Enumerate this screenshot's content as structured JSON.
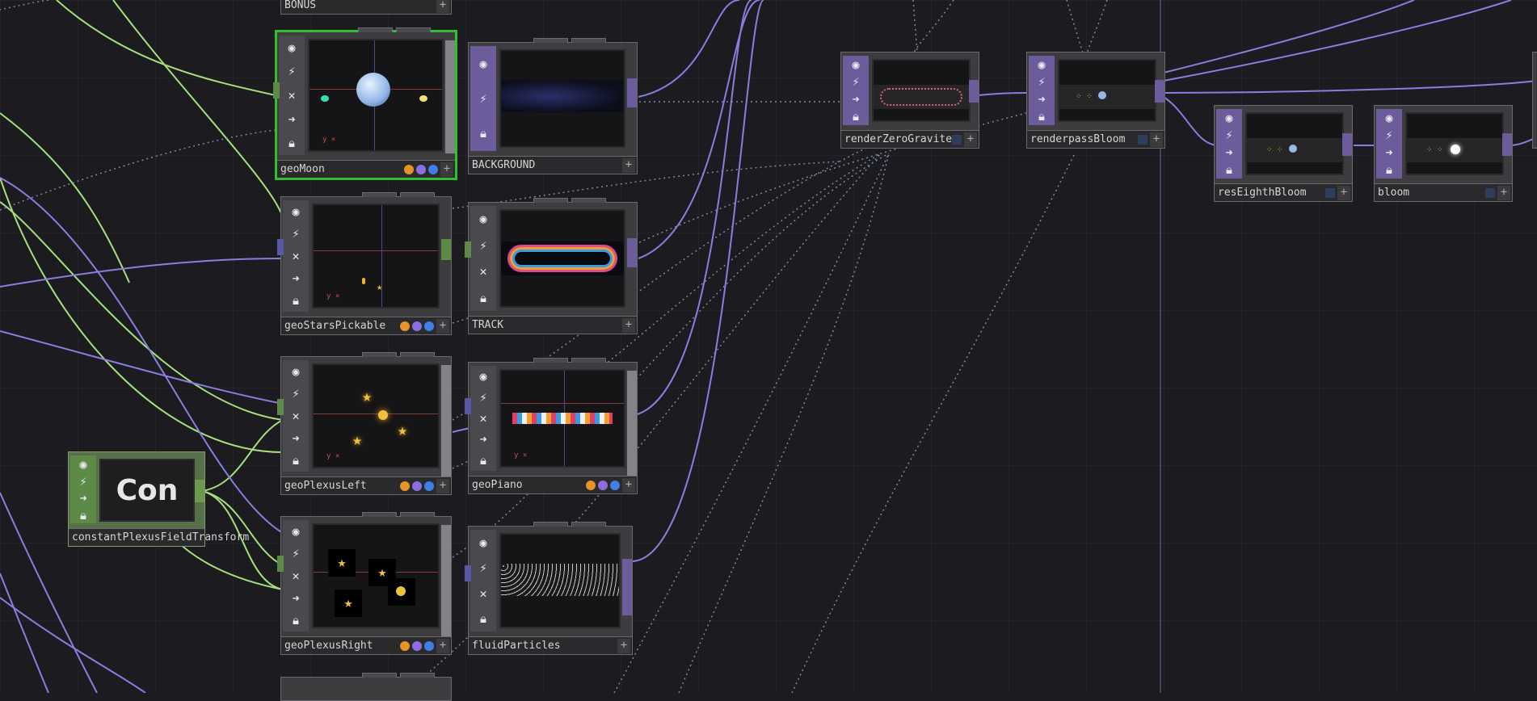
{
  "nodes": {
    "bonus": {
      "label": "BONUS"
    },
    "geoMoon": {
      "label": "geoMoon"
    },
    "background": {
      "label": "BACKGROUND"
    },
    "geoStarsPickable": {
      "label": "geoStarsPickable"
    },
    "track": {
      "label": "TRACK"
    },
    "geoPlexusLeft": {
      "label": "geoPlexusLeft"
    },
    "geoPiano": {
      "label": "geoPiano"
    },
    "geoPlexusRight": {
      "label": "geoPlexusRight"
    },
    "fluidParticles": {
      "label": "fluidParticles"
    },
    "renderZeroGravite": {
      "label": "renderZeroGravite"
    },
    "renderpassBloom": {
      "label": "renderpassBloom"
    },
    "resEighthBloom": {
      "label": "resEighthBloom"
    },
    "bloom": {
      "label": "bloom"
    },
    "constantPlexusFieldTransform": {
      "label": "constantPlexusFieldTransform",
      "viewer_text": "Con"
    }
  },
  "flag_colors": {
    "orange": "#e8922a",
    "purple": "#8c6ee0",
    "blue": "#3f7fe8"
  },
  "wire_colors": {
    "chop": "#a6e07a",
    "top": "#8a7de0",
    "dotted": "#7a8aa6"
  },
  "icons": [
    "viewer-icon",
    "bypass-icon",
    "delete-icon",
    "arrow-right-icon",
    "lock-icon"
  ],
  "add_glyph": "+"
}
